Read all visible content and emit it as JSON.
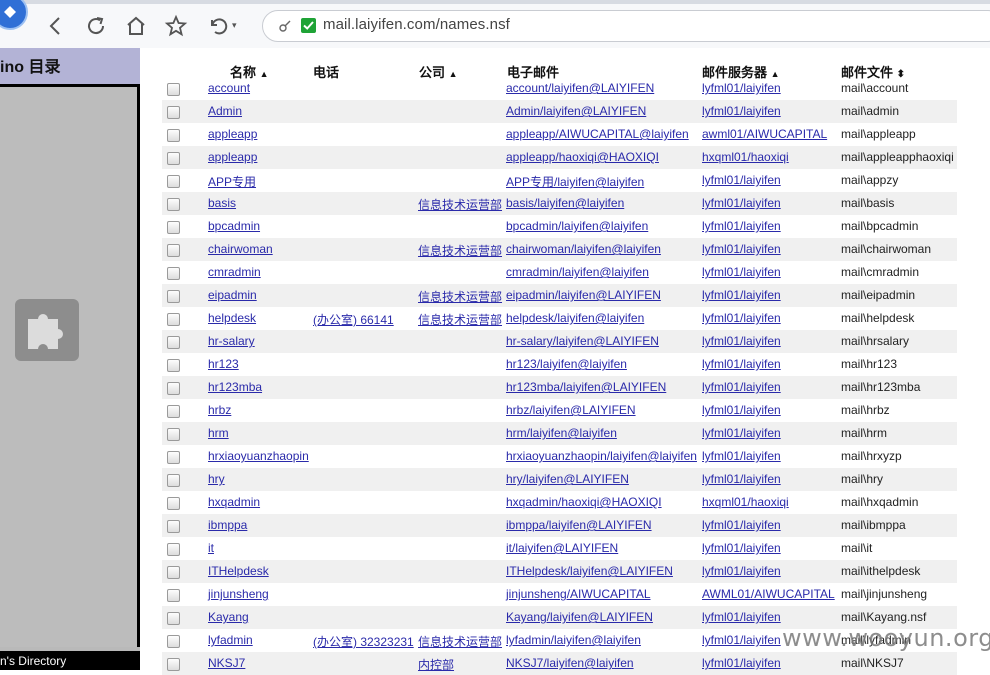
{
  "browser": {
    "url": "mail.laiyifen.com/names.nsf",
    "back_icon": "back-arrow-icon",
    "reload_icon": "reload-icon",
    "home_icon": "home-icon",
    "favorite_icon": "star-icon",
    "undo_icon": "undo-icon"
  },
  "left_panel": {
    "title": "ino 目录",
    "footer": "n's Directory"
  },
  "table": {
    "headers": {
      "name": "名称",
      "phone": "电话",
      "company": "公司",
      "email": "电子邮件",
      "server": "邮件服务器",
      "file": "邮件文件"
    },
    "rows": [
      {
        "name": "account",
        "phone": "",
        "company": "",
        "email": "account/laiyifen@LAIYIFEN",
        "server": "lyfml01/laiyifen",
        "file": "mail\\account"
      },
      {
        "name": "Admin",
        "phone": "",
        "company": "",
        "email": "Admin/laiyifen@LAIYIFEN",
        "server": "lyfml01/laiyifen",
        "file": "mail\\admin"
      },
      {
        "name": "appleapp",
        "phone": "",
        "company": "",
        "email": "appleapp/AIWUCAPITAL@laiyifen",
        "server": "awml01/AIWUCAPITAL",
        "file": "mail\\appleapp"
      },
      {
        "name": "appleapp",
        "phone": "",
        "company": "",
        "email": "appleapp/haoxiqi@HAOXIQI",
        "server": "hxqml01/haoxiqi",
        "file": "mail\\appleapphaoxiqi"
      },
      {
        "name": "APP专用",
        "phone": "",
        "company": "",
        "email": "APP专用/laiyifen@laiyifen",
        "server": "lyfml01/laiyifen",
        "file": "mail\\appzy"
      },
      {
        "name": "basis",
        "phone": "",
        "company": "信息技术运营部",
        "email": "basis/laiyifen@laiyifen",
        "server": "lyfml01/laiyifen",
        "file": "mail\\basis"
      },
      {
        "name": "bpcadmin",
        "phone": "",
        "company": "",
        "email": "bpcadmin/laiyifen@laiyifen",
        "server": "lyfml01/laiyifen",
        "file": "mail\\bpcadmin"
      },
      {
        "name": "chairwoman",
        "phone": "",
        "company": "信息技术运营部",
        "email": "chairwoman/laiyifen@laiyifen",
        "server": "lyfml01/laiyifen",
        "file": "mail\\chairwoman"
      },
      {
        "name": "cmradmin",
        "phone": "",
        "company": "",
        "email": "cmradmin/laiyifen@laiyifen",
        "server": "lyfml01/laiyifen",
        "file": "mail\\cmradmin"
      },
      {
        "name": "eipadmin",
        "phone": "",
        "company": "信息技术运营部",
        "email": "eipadmin/laiyifen@LAIYIFEN",
        "server": "lyfml01/laiyifen",
        "file": "mail\\eipadmin"
      },
      {
        "name": "helpdesk",
        "phone": "(办公室) 66141",
        "company": "信息技术运营部",
        "email": "helpdesk/laiyifen@laiyifen",
        "server": "lyfml01/laiyifen",
        "file": "mail\\helpdesk"
      },
      {
        "name": "hr-salary",
        "phone": "",
        "company": "",
        "email": "hr-salary/laiyifen@LAIYIFEN",
        "server": "lyfml01/laiyifen",
        "file": "mail\\hrsalary"
      },
      {
        "name": "hr123",
        "phone": "",
        "company": "",
        "email": "hr123/laiyifen@laiyifen",
        "server": "lyfml01/laiyifen",
        "file": "mail\\hr123"
      },
      {
        "name": "hr123mba",
        "phone": "",
        "company": "",
        "email": "hr123mba/laiyifen@LAIYIFEN",
        "server": "lyfml01/laiyifen",
        "file": "mail\\hr123mba"
      },
      {
        "name": "hrbz",
        "phone": "",
        "company": "",
        "email": "hrbz/laiyifen@LAIYIFEN",
        "server": "lyfml01/laiyifen",
        "file": "mail\\hrbz"
      },
      {
        "name": "hrm",
        "phone": "",
        "company": "",
        "email": "hrm/laiyifen@laiyifen",
        "server": "lyfml01/laiyifen",
        "file": "mail\\hrm"
      },
      {
        "name": "hrxiaoyuanzhaopin",
        "phone": "",
        "company": "",
        "email": "hrxiaoyuanzhaopin/laiyifen@laiyifen",
        "server": "lyfml01/laiyifen",
        "file": "mail\\hrxyzp"
      },
      {
        "name": "hry",
        "phone": "",
        "company": "",
        "email": "hry/laiyifen@LAIYIFEN",
        "server": "lyfml01/laiyifen",
        "file": "mail\\hry"
      },
      {
        "name": "hxqadmin",
        "phone": "",
        "company": "",
        "email": "hxqadmin/haoxiqi@HAOXIQI",
        "server": "hxqml01/haoxiqi",
        "file": "mail\\hxqadmin"
      },
      {
        "name": "ibmppa",
        "phone": "",
        "company": "",
        "email": "ibmppa/laiyifen@LAIYIFEN",
        "server": "lyfml01/laiyifen",
        "file": "mail\\ibmppa"
      },
      {
        "name": "it",
        "phone": "",
        "company": "",
        "email": "it/laiyifen@LAIYIFEN",
        "server": "lyfml01/laiyifen",
        "file": "mail\\it"
      },
      {
        "name": "ITHelpdesk",
        "phone": "",
        "company": "",
        "email": "ITHelpdesk/laiyifen@LAIYIFEN",
        "server": "lyfml01/laiyifen",
        "file": "mail\\ithelpdesk"
      },
      {
        "name": "jinjunsheng",
        "phone": "",
        "company": "",
        "email": "jinjunsheng/AIWUCAPITAL",
        "server": "AWML01/AIWUCAPITAL",
        "file": "mail\\jinjunsheng"
      },
      {
        "name": "Kayang",
        "phone": "",
        "company": "",
        "email": "Kayang/laiyifen@LAIYIFEN",
        "server": "lyfml01/laiyifen",
        "file": "mail\\Kayang.nsf"
      },
      {
        "name": "lyfadmin",
        "phone": "(办公室) 32323231",
        "company": "信息技术运营部",
        "email": "lyfadmin/laiyifen@laiyifen",
        "server": "lyfml01/laiyifen",
        "file": "mail\\lyfadmin"
      },
      {
        "name": "NKSJ7",
        "phone": "",
        "company": "内控部",
        "email": "NKSJ7/laiyifen@laiyifen",
        "server": "lyfml01/laiyifen",
        "file": "mail\\NKSJ7"
      }
    ]
  },
  "watermark": "www.wooyun.org"
}
